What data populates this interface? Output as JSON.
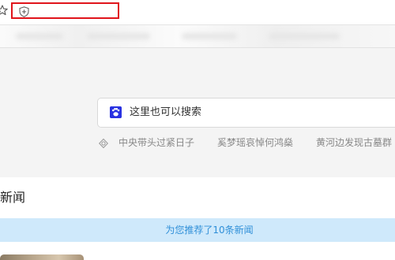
{
  "search": {
    "placeholder": "这里也可以搜索"
  },
  "hot_searches": [
    "中央带头过紧日子",
    "奚梦瑶哀悼何鸿燊",
    "黄河边发现古墓群"
  ],
  "news": {
    "title": "新闻",
    "recommend_text": "为您推荐了10条新闻"
  },
  "icons": {
    "star": "star-icon",
    "shield": "shield-icon",
    "search_logo": "paw-icon",
    "hot": "eye-icon"
  },
  "colors": {
    "highlight": "#e0141b",
    "search_logo": "#2932e1",
    "recommend_bg": "#cfe9fb",
    "recommend_text": "#2f8fd8"
  }
}
